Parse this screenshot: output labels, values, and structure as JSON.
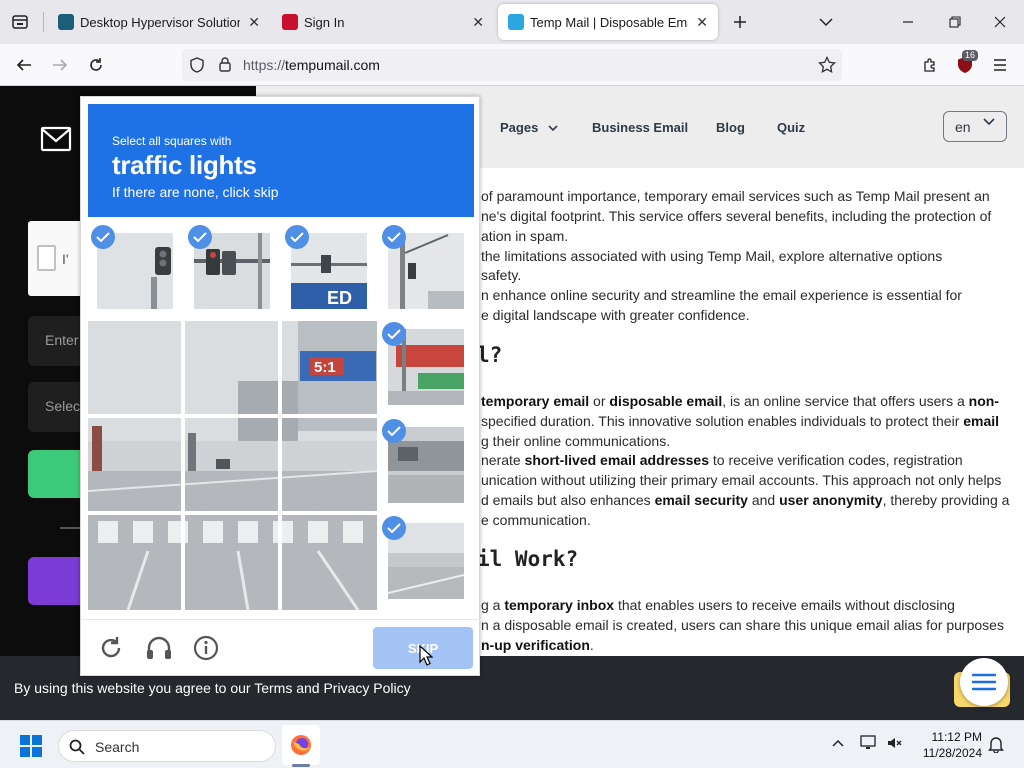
{
  "browser": {
    "tabs": [
      {
        "title": "Desktop Hypervisor Solutions |",
        "favicon_color": "#1b5e7a",
        "close": "✕"
      },
      {
        "title": "Sign In",
        "favicon_color": "#c8102e",
        "close": "✕"
      },
      {
        "title": "Temp Mail | Disposable Email A",
        "favicon_color": "#2aa7e0",
        "close": "✕"
      }
    ],
    "url_scheme": "https://",
    "url_host": "tempumail.com",
    "extension_badge": "16"
  },
  "site": {
    "nav": {
      "pages": "Pages",
      "business": "Business Email",
      "blog": "Blog",
      "quiz": "Quiz"
    },
    "lang": "en",
    "left_panel": {
      "checkbox_label": "I'",
      "email_input_text": "Enter",
      "select_text": "Selec"
    }
  },
  "article": {
    "lines": [
      "of paramount importance, temporary email services such as Temp Mail present an",
      "ne's digital footprint. This service offers several benefits, including the protection of",
      "ation in spam.",
      "the limitations associated with using Temp Mail, explore alternative options",
      "safety.",
      "n enhance online security and streamline the email experience is essential for",
      "e digital landscape with greater confidence."
    ],
    "heading1": "l?",
    "p2": [
      {
        "segments": [
          {
            "t": "temporary email",
            "b": true
          },
          {
            "t": " or ",
            "b": false
          },
          {
            "t": "disposable email",
            "b": true
          },
          {
            "t": ", is an online service that offers users a ",
            "b": false
          },
          {
            "t": "non-",
            "b": true
          }
        ]
      },
      {
        "segments": [
          {
            "t": "specified duration. This innovative solution enables individuals to protect their ",
            "b": false
          },
          {
            "t": "email",
            "b": true
          }
        ]
      },
      {
        "segments": [
          {
            "t": "g their online communications.",
            "b": false
          }
        ]
      },
      {
        "segments": [
          {
            "t": "nerate ",
            "b": false
          },
          {
            "t": "short-lived email addresses",
            "b": true
          },
          {
            "t": " to receive verification codes, registration",
            "b": false
          }
        ]
      },
      {
        "segments": [
          {
            "t": "unication without utilizing their primary email accounts. This approach not only helps",
            "b": false
          }
        ]
      },
      {
        "segments": [
          {
            "t": "d emails but also enhances ",
            "b": false
          },
          {
            "t": "email security",
            "b": true
          },
          {
            "t": " and ",
            "b": false
          },
          {
            "t": "user anonymity",
            "b": true
          },
          {
            "t": ", thereby providing a",
            "b": false
          }
        ]
      },
      {
        "segments": [
          {
            "t": "e communication.",
            "b": false
          }
        ]
      }
    ],
    "heading2": "il Work?",
    "p3": [
      {
        "segments": [
          {
            "t": "g a ",
            "b": false
          },
          {
            "t": "temporary inbox",
            "b": true
          },
          {
            "t": " that enables users to receive emails without disclosing",
            "b": false
          }
        ]
      },
      {
        "segments": [
          {
            "t": "n a disposable email is created, users can share this unique email alias for purposes",
            "b": false
          }
        ]
      },
      {
        "segments": [
          {
            "t": "n-up verification",
            "b": true
          },
          {
            "t": ".",
            "b": false
          }
        ]
      }
    ]
  },
  "cookie": {
    "text": "By using this website you agree to our Terms and Privacy Policy"
  },
  "captcha": {
    "instruction": "Select all squares with",
    "target_word": "traffic lights",
    "hint": "If there are none, click skip",
    "skip_label": "SKIP",
    "example_checks": 4,
    "side_checks": 3
  },
  "taskbar": {
    "search_label": "Search",
    "time": "11:12 PM",
    "date": "11/28/2024"
  }
}
